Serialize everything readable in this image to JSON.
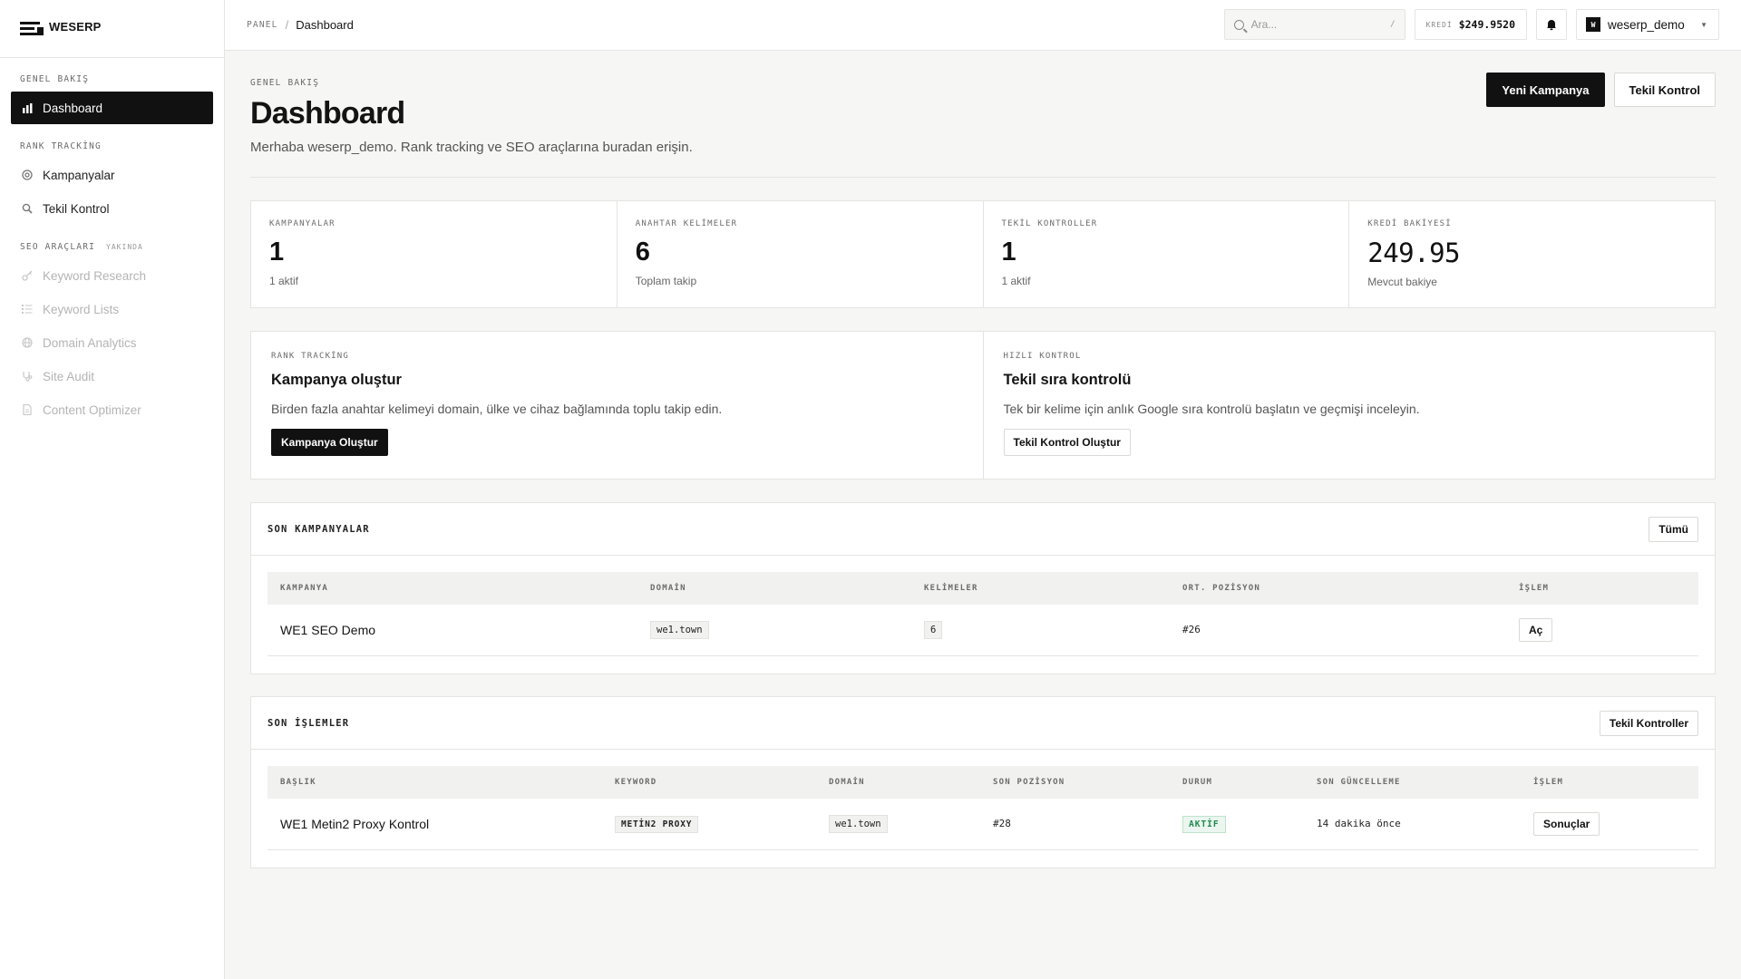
{
  "brand": {
    "name": "WESERP"
  },
  "sidebar": {
    "sections": [
      {
        "label": "GENEL BAKIŞ"
      },
      {
        "label": "RANK TRACKİNG"
      },
      {
        "label": "SEO ARAÇLARI",
        "badge": "YAKINDA"
      }
    ],
    "items": [
      {
        "label": "Dashboard",
        "icon": "bar-chart-icon"
      },
      {
        "label": "Kampanyalar",
        "icon": "target-icon"
      },
      {
        "label": "Tekil Kontrol",
        "icon": "search-icon"
      },
      {
        "label": "Keyword Research",
        "icon": "key-icon"
      },
      {
        "label": "Keyword Lists",
        "icon": "list-icon"
      },
      {
        "label": "Domain Analytics",
        "icon": "globe-icon"
      },
      {
        "label": "Site Audit",
        "icon": "stethoscope-icon"
      },
      {
        "label": "Content Optimizer",
        "icon": "document-icon"
      }
    ]
  },
  "topbar": {
    "breadcrumb_root": "PANEL",
    "breadcrumb_sep": "/",
    "breadcrumb_current": "Dashboard",
    "search_placeholder": "Ara...",
    "search_shortcut": "/",
    "credit_label": "KREDİ",
    "credit_value": "$249.9520",
    "user_initial": "W",
    "user_name": "weserp_demo"
  },
  "header": {
    "eyebrow": "GENEL BAKIŞ",
    "title": "Dashboard",
    "subtitle": "Merhaba weserp_demo. Rank tracking ve SEO araçlarına buradan erişin.",
    "primary_action": "Yeni Kampanya",
    "secondary_action": "Tekil Kontrol"
  },
  "stats": [
    {
      "label": "KAMPANYALAR",
      "value": "1",
      "note": "1 aktif"
    },
    {
      "label": "ANAHTAR KELİMELER",
      "value": "6",
      "note": "Toplam takip"
    },
    {
      "label": "TEKİL KONTROLLER",
      "value": "1",
      "note": "1 aktif"
    },
    {
      "label": "KREDİ BAKİYESİ",
      "value": "249.95",
      "note": "Mevcut bakiye"
    }
  ],
  "cards": [
    {
      "eyebrow": "RANK TRACKİNG",
      "title": "Kampanya oluştur",
      "desc": "Birden fazla anahtar kelimeyi domain, ülke ve cihaz bağlamında toplu takip edin.",
      "button": "Kampanya Oluştur"
    },
    {
      "eyebrow": "HIZLI KONTROL",
      "title": "Tekil sıra kontrolü",
      "desc": "Tek bir kelime için anlık Google sıra kontrolü başlatın ve geçmişi inceleyin.",
      "button": "Tekil Kontrol Oluştur"
    }
  ],
  "campaigns": {
    "title": "SON KAMPANYALAR",
    "action": "Tümü",
    "columns": [
      "KAMPANYA",
      "DOMAİN",
      "KELİMELER",
      "ORT. POZİSYON",
      "İŞLEM"
    ],
    "rows": [
      {
        "name": "WE1 SEO Demo",
        "domain": "we1.town",
        "keywords": "6",
        "avg_position": "#26",
        "action": "Aç"
      }
    ]
  },
  "operations": {
    "title": "SON İŞLEMLER",
    "action": "Tekil Kontroller",
    "columns": [
      "BAŞLIK",
      "KEYWORD",
      "DOMAİN",
      "SON POZİSYON",
      "DURUM",
      "SON GÜNCELLEME",
      "İŞLEM"
    ],
    "rows": [
      {
        "title": "WE1 Metin2 Proxy Kontrol",
        "keyword": "METİN2 PROXY",
        "domain": "we1.town",
        "last_position": "#28",
        "status": "AKTİF",
        "updated": "14 dakika önce",
        "action": "Sonuçlar"
      }
    ]
  },
  "colors": {
    "accent": "#111111",
    "background": "#f6f6f4",
    "border": "#e4e4e2",
    "status_ok": "#1f8a4c"
  }
}
